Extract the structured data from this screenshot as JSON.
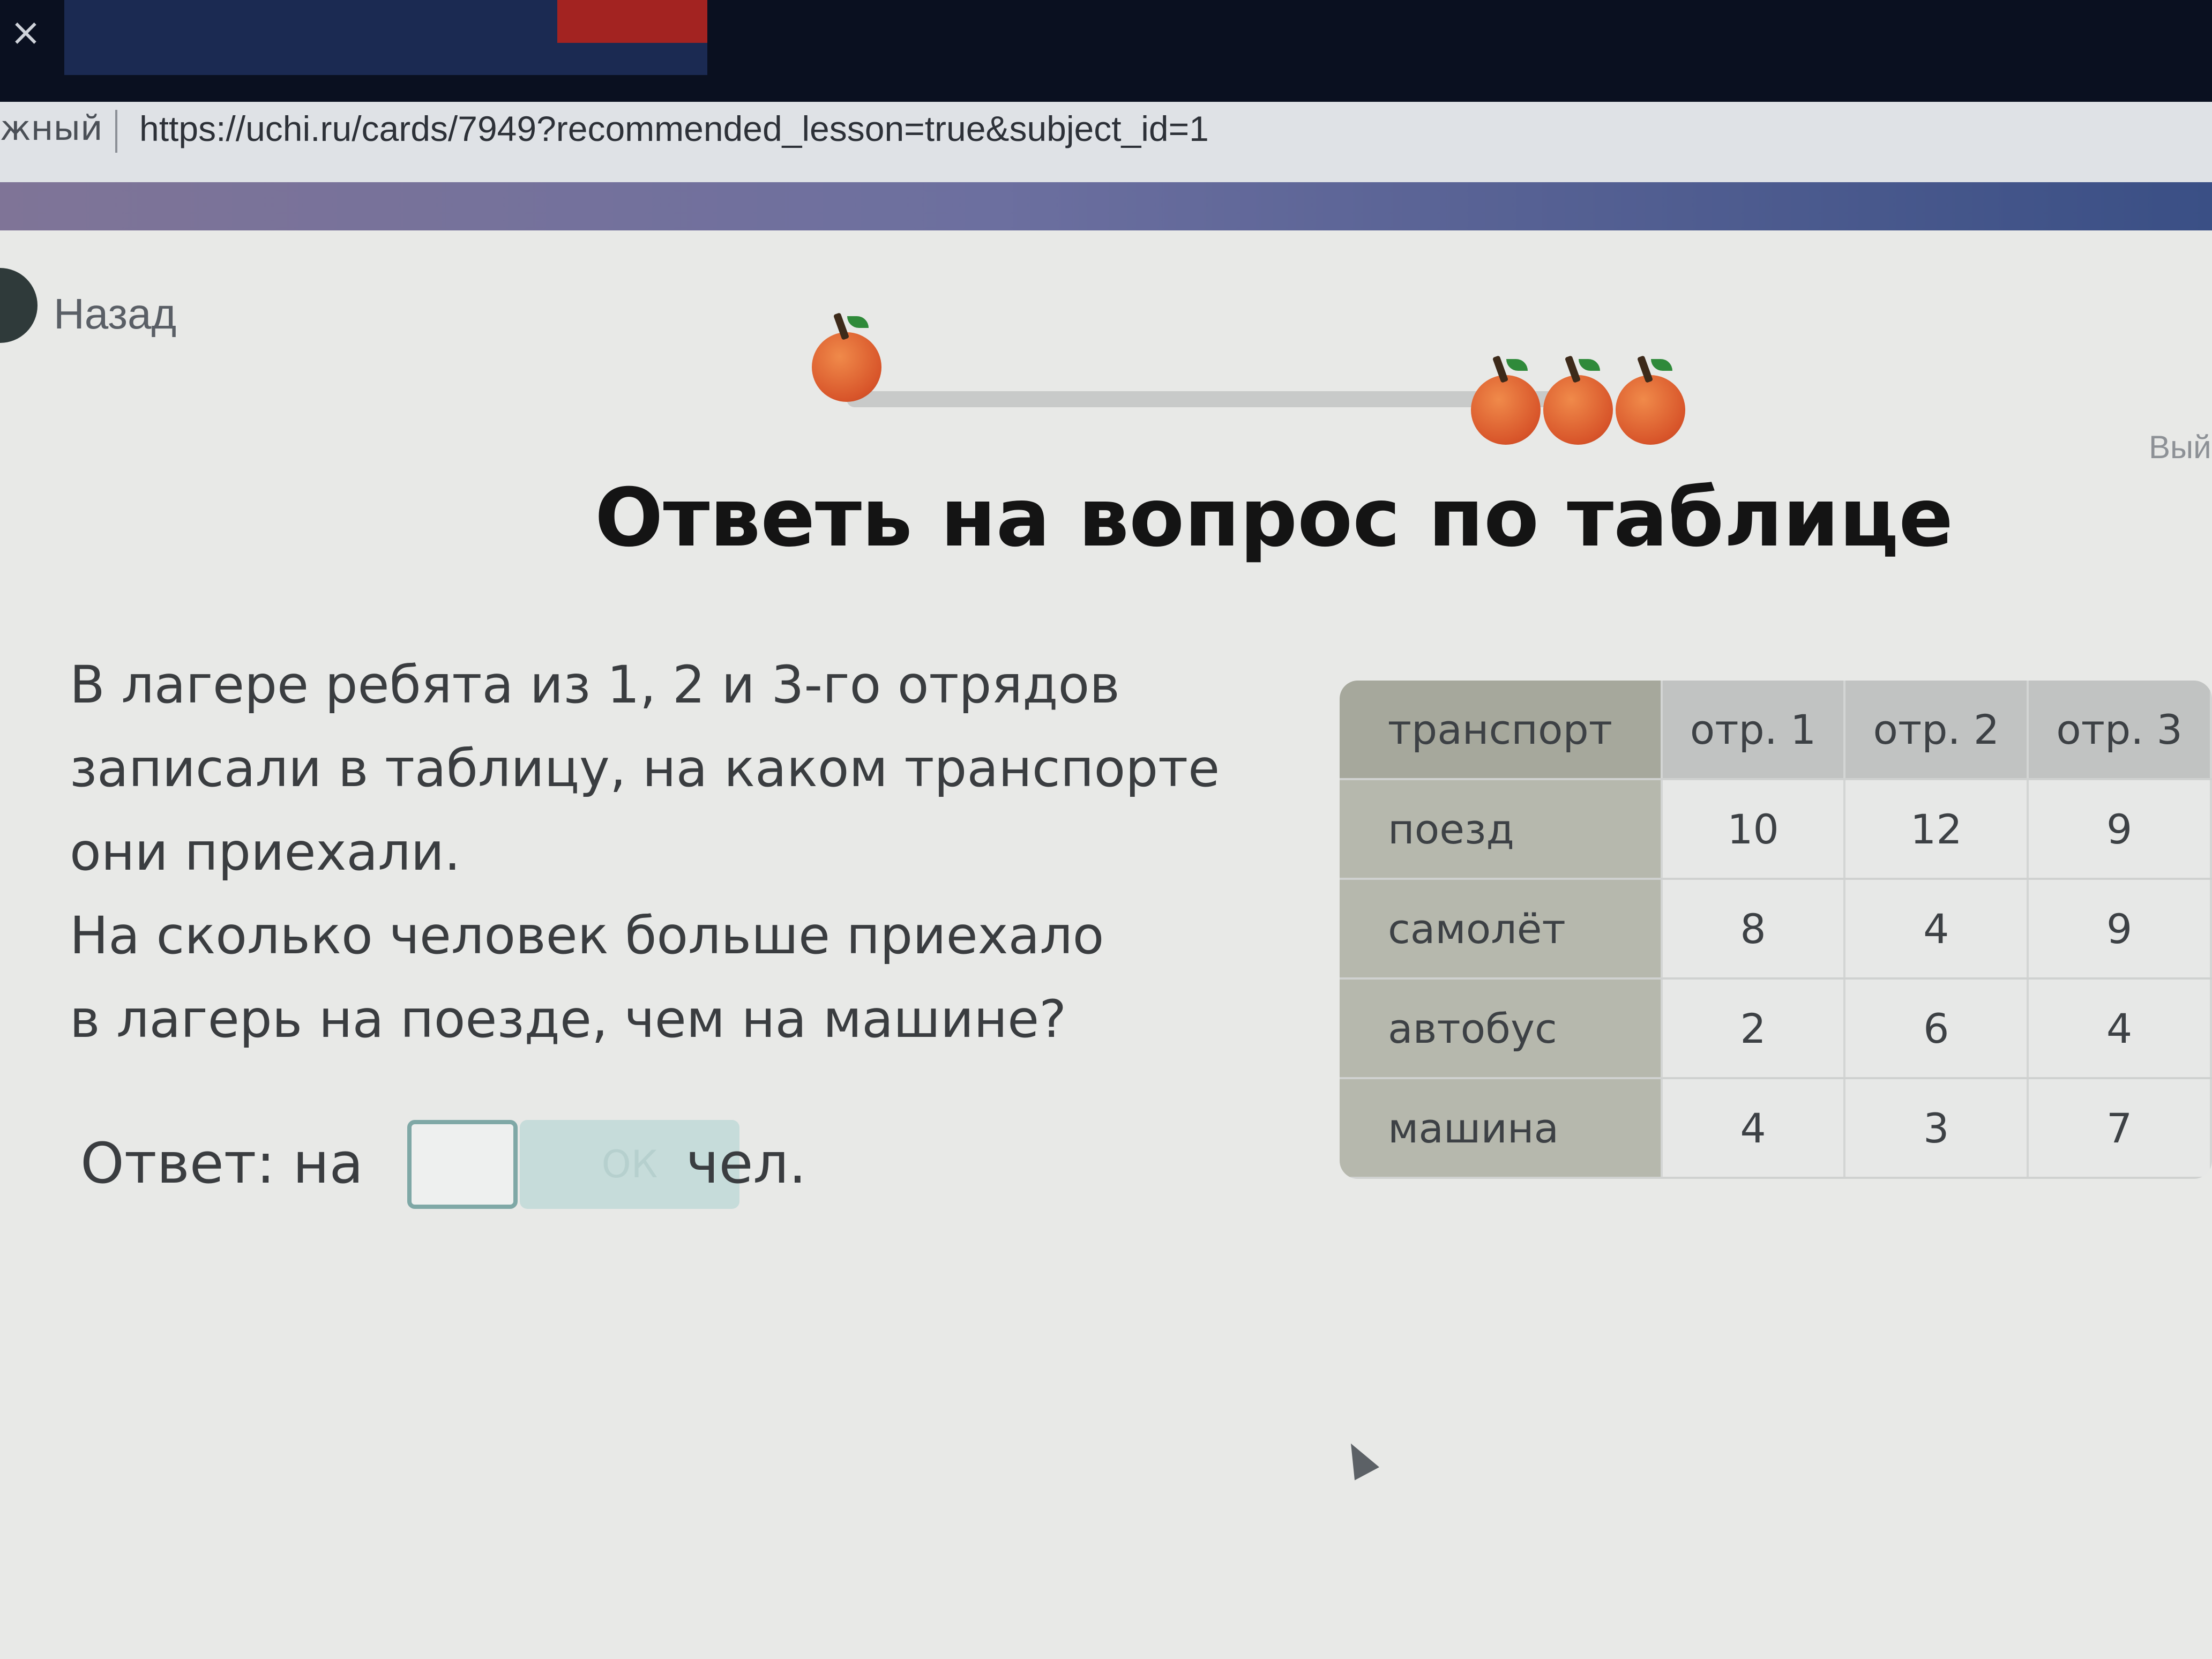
{
  "browser": {
    "tab_close_glyph": "×",
    "address_left_text": "жный",
    "url": "https://uchi.ru/cards/7949?recommended_lesson=true&subject_id=1"
  },
  "nav": {
    "back_label": "Назад",
    "right_partial_label": "Вый"
  },
  "progress": {
    "current_apples": 1,
    "target_apples": 3
  },
  "task": {
    "title": "Ответь на вопрос по таблице",
    "question_lines": [
      "В лагере ребята из 1, 2 и 3-го отрядов",
      "записали в таблицу, на каком транспорте",
      "они приехали.",
      "На сколько человек больше приехало",
      "в лагерь на поезде, чем на машине?"
    ],
    "answer_prefix": "Ответ: на",
    "answer_value": "",
    "ok_label": "ОК",
    "answer_unit": "чел."
  },
  "table": {
    "headers": [
      "транспорт",
      "отр. 1",
      "отр. 2",
      "отр. 3"
    ],
    "rows": [
      [
        "поезд",
        "10",
        "12",
        "9"
      ],
      [
        "самолёт",
        "8",
        "4",
        "9"
      ],
      [
        "автобус",
        "2",
        "6",
        "4"
      ],
      [
        "машина",
        "4",
        "3",
        "7"
      ]
    ]
  },
  "colors": {
    "accent_teal": "#7fa8a6",
    "apple_orange": "#d8552a",
    "title_text": "#141414"
  }
}
